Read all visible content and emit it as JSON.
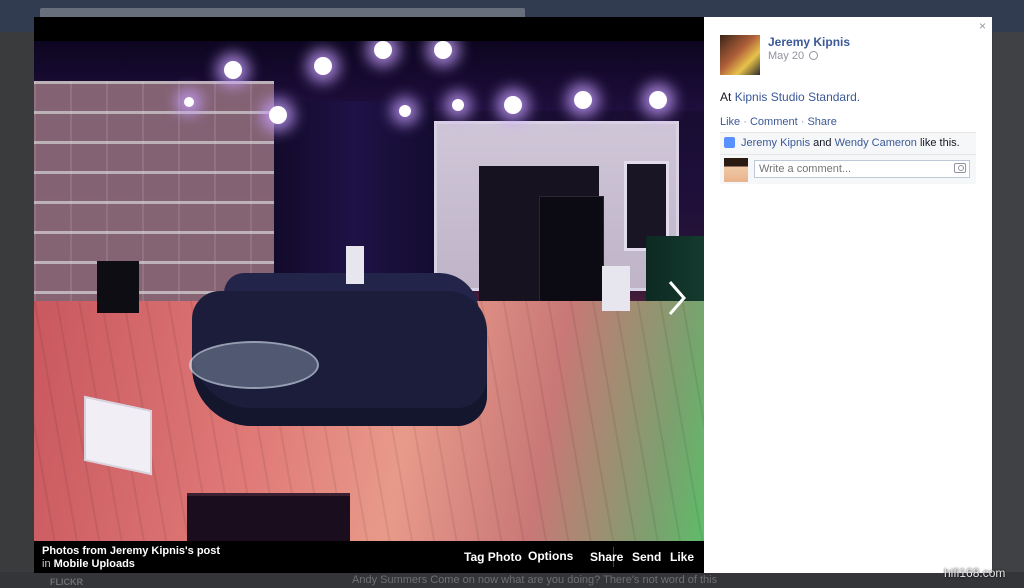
{
  "background": {
    "flickr_label": "FLICKR",
    "feed_snippet": "Andy Summers Come on now what are you doing? There's not word of this"
  },
  "photo": {
    "source_line": "Photos from Jeremy Kipnis's post",
    "album_prefix": "in",
    "album": "Mobile Uploads",
    "actions": {
      "tag_photo": "Tag Photo",
      "options": "Options",
      "share": "Share",
      "send": "Send",
      "like": "Like"
    }
  },
  "panel": {
    "author": "Jeremy Kipnis",
    "date": "May 20",
    "post_prefix": "At",
    "post_link": "Kipnis Studio Standard.",
    "actions": {
      "like": "Like",
      "comment": "Comment",
      "share": "Share",
      "sep": "·"
    },
    "likes": {
      "user1": "Jeremy Kipnis",
      "and": "and",
      "user2": "Wendy Cameron",
      "suffix": "like this."
    },
    "comment_placeholder": "Write a comment...",
    "close_glyph": "×"
  },
  "watermark": "hifi168.com",
  "colors": {
    "link": "#3b5998",
    "like_thumb": "#5890ff"
  }
}
